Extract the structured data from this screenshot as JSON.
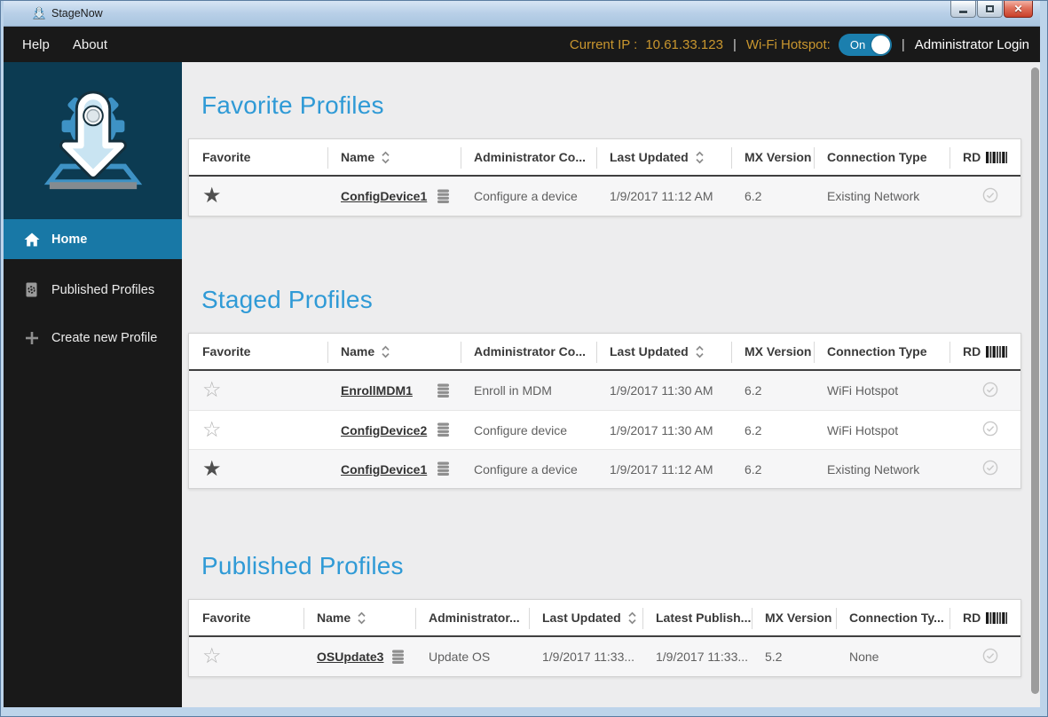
{
  "window": {
    "title": "StageNow"
  },
  "menubar": {
    "items": [
      "Help",
      "About"
    ],
    "current_ip_label": "Current IP :",
    "current_ip_value": "10.61.33.123",
    "separator": "|",
    "wifi_hotspot_label": "Wi-Fi Hotspot:",
    "wifi_hotspot_state": "On",
    "admin_login_label": "Administrator Login"
  },
  "sidebar": {
    "items": [
      {
        "label": "Home",
        "icon": "home-icon",
        "active": true
      },
      {
        "label": "Published Profiles",
        "icon": "published-profiles-icon",
        "active": false
      },
      {
        "label": "Create new Profile",
        "icon": "plus-icon",
        "active": false
      }
    ]
  },
  "sections": [
    {
      "title": "Favorite Profiles",
      "columns": [
        {
          "label": "Favorite"
        },
        {
          "label": "Name",
          "sort": true
        },
        {
          "label": "Administrator Co..."
        },
        {
          "label": "Last Updated",
          "sort": true
        },
        {
          "label": "MX Version"
        },
        {
          "label": "Connection Type"
        },
        {
          "label": "RD",
          "barcode": true
        }
      ],
      "fields": [
        "favorite",
        "name",
        "admin",
        "updated",
        "mx",
        "connection",
        "rd"
      ],
      "rows": [
        {
          "favorite": true,
          "name": "ConfigDevice1",
          "admin": "Configure a device",
          "updated": "1/9/2017 11:12 AM",
          "mx": "6.2",
          "connection": "Existing Network"
        }
      ]
    },
    {
      "title": "Staged Profiles",
      "columns": [
        {
          "label": "Favorite"
        },
        {
          "label": "Name",
          "sort": true
        },
        {
          "label": "Administrator Co..."
        },
        {
          "label": "Last Updated",
          "sort": true
        },
        {
          "label": "MX Version"
        },
        {
          "label": "Connection Type"
        },
        {
          "label": "RD",
          "barcode": true
        }
      ],
      "fields": [
        "favorite",
        "name",
        "admin",
        "updated",
        "mx",
        "connection",
        "rd"
      ],
      "rows": [
        {
          "favorite": false,
          "name": "EnrollMDM1",
          "admin": "Enroll in MDM",
          "updated": "1/9/2017 11:30 AM",
          "mx": "6.2",
          "connection": "WiFi Hotspot"
        },
        {
          "favorite": false,
          "name": "ConfigDevice2",
          "admin": "Configure device",
          "updated": "1/9/2017 11:30 AM",
          "mx": "6.2",
          "connection": "WiFi Hotspot"
        },
        {
          "favorite": true,
          "name": "ConfigDevice1",
          "admin": "Configure a device",
          "updated": "1/9/2017 11:12 AM",
          "mx": "6.2",
          "connection": "Existing Network"
        }
      ]
    },
    {
      "title": "Published Profiles",
      "columns": [
        {
          "label": "Favorite"
        },
        {
          "label": "Name",
          "sort": true
        },
        {
          "label": "Administrator..."
        },
        {
          "label": "Last Updated",
          "sort": true
        },
        {
          "label": "Latest Publish..."
        },
        {
          "label": "MX Version"
        },
        {
          "label": "Connection Ty..."
        },
        {
          "label": "RD",
          "barcode": true
        }
      ],
      "fields": [
        "favorite",
        "name",
        "admin",
        "updated",
        "published",
        "mx",
        "connection",
        "rd"
      ],
      "rows": [
        {
          "favorite": false,
          "name": "OSUpdate3",
          "admin": "Update OS",
          "updated": "1/9/2017 11:33...",
          "published": "1/9/2017 11:33...",
          "mx": "5.2",
          "connection": "None"
        }
      ]
    }
  ],
  "colors": {
    "section_title_blue": "#2f9ad6",
    "active_nav_blue": "#1878a6",
    "logo_background": "#0c3b52",
    "menubar_amber": "#c9962e",
    "toggle_blue": "#1b7fae",
    "close_button_red": "#c8402a"
  }
}
